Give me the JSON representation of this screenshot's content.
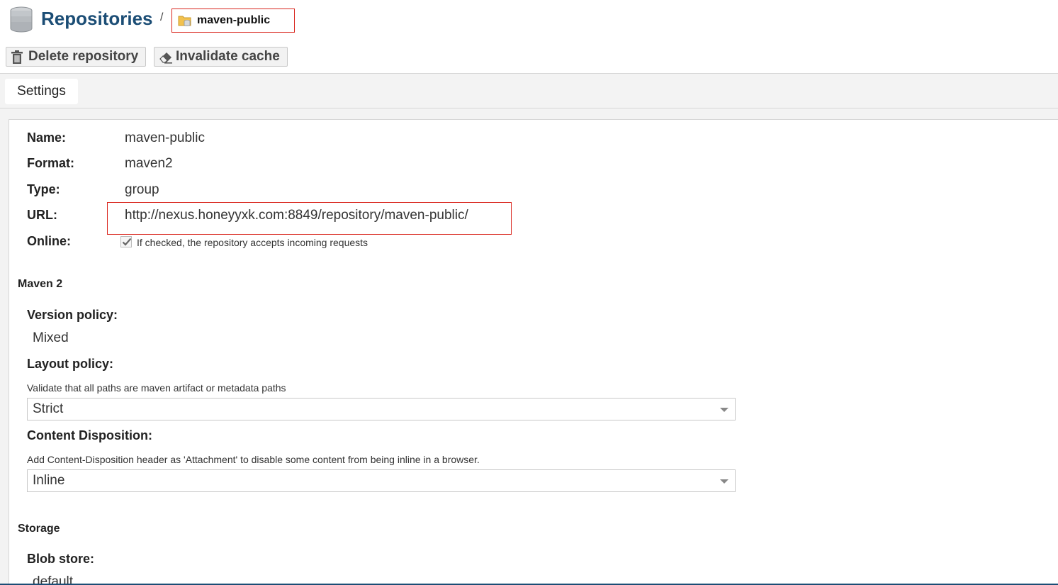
{
  "header": {
    "title": "Repositories",
    "separator": "/",
    "breadcrumb_current": "maven-public",
    "icons": {
      "repositories": "database-icon",
      "breadcrumb": "folder-database-icon"
    }
  },
  "toolbar": {
    "delete_label": "Delete repository",
    "invalidate_label": "Invalidate cache",
    "icons": {
      "delete": "trash-icon",
      "invalidate": "eraser-icon"
    }
  },
  "tabs": [
    {
      "label": "Settings",
      "active": true
    }
  ],
  "settings": {
    "name_label": "Name:",
    "name_value": "maven-public",
    "format_label": "Format:",
    "format_value": "maven2",
    "type_label": "Type:",
    "type_value": "group",
    "url_label": "URL:",
    "url_value": "http://nexus.honeyyxk.com:8849/repository/maven-public/",
    "online_label": "Online:",
    "online_checked": true,
    "online_help": "If checked, the repository accepts incoming requests"
  },
  "maven": {
    "section_title": "Maven 2",
    "version_policy_label": "Version policy:",
    "version_policy_value": "Mixed",
    "layout_policy_label": "Layout policy:",
    "layout_policy_help": "Validate that all paths are maven artifact or metadata paths",
    "layout_policy_value": "Strict",
    "content_disposition_label": "Content Disposition:",
    "content_disposition_help": "Add Content-Disposition header as 'Attachment' to disable some content from being inline in a browser.",
    "content_disposition_value": "Inline"
  },
  "storage": {
    "section_title": "Storage",
    "blob_store_label": "Blob store:",
    "blob_store_value": "default"
  },
  "colors": {
    "title": "#1b4d75",
    "highlight_border": "#d9251d",
    "toolbar_bg": "#f2f2f2",
    "page_bg": "#f3f3f3"
  }
}
